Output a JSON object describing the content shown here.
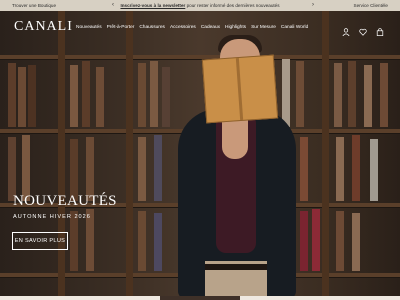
{
  "announcement": {
    "store_link": "Trouver une Boutique",
    "newsletter_link": "Inscrivez-vous à la newsletter",
    "newsletter_text": " pour rester informé des dernières nouveautés",
    "service_link": "Service Clientèle",
    "prev_arrow": "‹",
    "next_arrow": "›"
  },
  "header": {
    "logo": "CANALI",
    "nav": [
      "Nouveautés",
      "Prêt-à-Porter",
      "Chaussures",
      "Accessoires",
      "Cadeaux",
      "Highlights",
      "Sur Mesure",
      "Canali World"
    ],
    "icons": [
      "user-icon",
      "heart-icon",
      "bag-icon"
    ]
  },
  "hero": {
    "title": "NOUVEAUTÉS",
    "subtitle": "AUTONNE HIVER 2026",
    "cta": "EN SAVOIR PLUS"
  },
  "colors": {
    "announcement_bg": "#d7d0c3",
    "hero_text": "#ffffff"
  }
}
